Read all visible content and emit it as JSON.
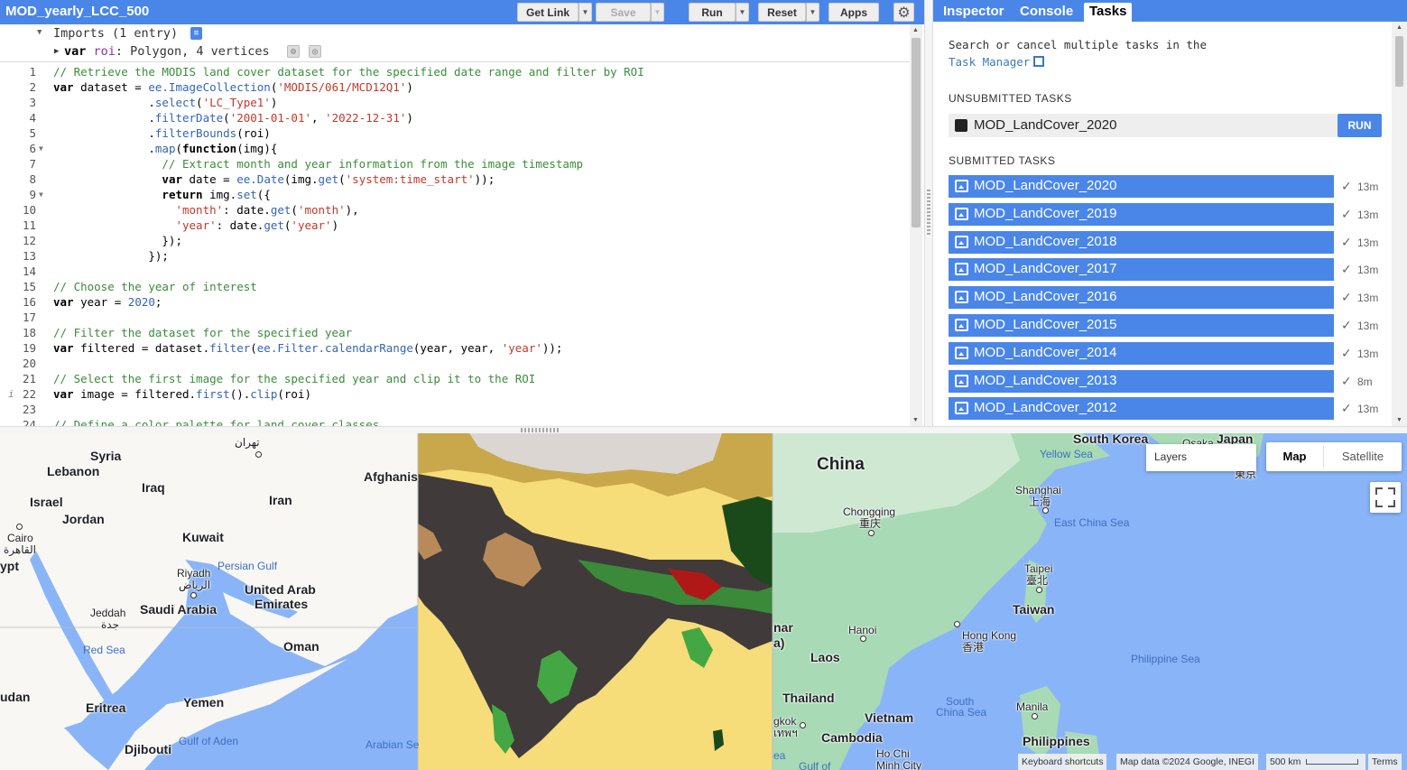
{
  "editor": {
    "script_title": "MOD_yearly_LCC_500",
    "buttons": {
      "get_link": "Get Link",
      "save": "Save",
      "run": "Run",
      "reset": "Reset",
      "apps": "Apps"
    },
    "imports_label": "Imports (1 entry)",
    "import_entry": {
      "keyword": "var",
      "name": "roi",
      "description": ": Polygon, 4 vertices"
    },
    "code_lines": [
      {
        "n": "1",
        "segments": [
          {
            "t": "// Retrieve the MODIS land cover dataset for the specified date range and filter by ROI",
            "c": "c"
          }
        ]
      },
      {
        "n": "2",
        "segments": [
          {
            "t": "var",
            "c": "k"
          },
          {
            "t": " dataset = ",
            "c": "p"
          },
          {
            "t": "ee.ImageCollection",
            "c": "f"
          },
          {
            "t": "(",
            "c": "p"
          },
          {
            "t": "'MODIS/061/MCD12Q1'",
            "c": "s"
          },
          {
            "t": ")",
            "c": "p"
          }
        ]
      },
      {
        "n": "3",
        "segments": [
          {
            "t": "              .",
            "c": "p"
          },
          {
            "t": "select",
            "c": "f"
          },
          {
            "t": "(",
            "c": "p"
          },
          {
            "t": "'LC_Type1'",
            "c": "s"
          },
          {
            "t": ")",
            "c": "p"
          }
        ]
      },
      {
        "n": "4",
        "segments": [
          {
            "t": "              .",
            "c": "p"
          },
          {
            "t": "filterDate",
            "c": "f"
          },
          {
            "t": "(",
            "c": "p"
          },
          {
            "t": "'2001-01-01'",
            "c": "s"
          },
          {
            "t": ", ",
            "c": "p"
          },
          {
            "t": "'2022-12-31'",
            "c": "s"
          },
          {
            "t": ")",
            "c": "p"
          }
        ]
      },
      {
        "n": "5",
        "segments": [
          {
            "t": "              .",
            "c": "p"
          },
          {
            "t": "filterBounds",
            "c": "f"
          },
          {
            "t": "(roi)",
            "c": "p"
          }
        ]
      },
      {
        "n": "6",
        "fold": true,
        "segments": [
          {
            "t": "              .",
            "c": "p"
          },
          {
            "t": "map",
            "c": "f"
          },
          {
            "t": "(",
            "c": "p"
          },
          {
            "t": "function",
            "c": "k"
          },
          {
            "t": "(img){",
            "c": "p"
          }
        ]
      },
      {
        "n": "7",
        "segments": [
          {
            "t": "                // Extract month and year information from the image timestamp",
            "c": "c"
          }
        ]
      },
      {
        "n": "8",
        "segments": [
          {
            "t": "                ",
            "c": "p"
          },
          {
            "t": "var",
            "c": "k"
          },
          {
            "t": " date = ",
            "c": "p"
          },
          {
            "t": "ee.Date",
            "c": "f"
          },
          {
            "t": "(img.",
            "c": "p"
          },
          {
            "t": "get",
            "c": "f"
          },
          {
            "t": "(",
            "c": "p"
          },
          {
            "t": "'system:time_start'",
            "c": "s"
          },
          {
            "t": "));",
            "c": "p"
          }
        ]
      },
      {
        "n": "9",
        "fold": true,
        "segments": [
          {
            "t": "                ",
            "c": "p"
          },
          {
            "t": "return",
            "c": "k"
          },
          {
            "t": " img.",
            "c": "p"
          },
          {
            "t": "set",
            "c": "f"
          },
          {
            "t": "({",
            "c": "p"
          }
        ]
      },
      {
        "n": "10",
        "segments": [
          {
            "t": "                  ",
            "c": "p"
          },
          {
            "t": "'month'",
            "c": "s"
          },
          {
            "t": ": date.",
            "c": "p"
          },
          {
            "t": "get",
            "c": "f"
          },
          {
            "t": "(",
            "c": "p"
          },
          {
            "t": "'month'",
            "c": "s"
          },
          {
            "t": "),",
            "c": "p"
          }
        ]
      },
      {
        "n": "11",
        "segments": [
          {
            "t": "                  ",
            "c": "p"
          },
          {
            "t": "'year'",
            "c": "s"
          },
          {
            "t": ": date.",
            "c": "p"
          },
          {
            "t": "get",
            "c": "f"
          },
          {
            "t": "(",
            "c": "p"
          },
          {
            "t": "'year'",
            "c": "s"
          },
          {
            "t": ")",
            "c": "p"
          }
        ]
      },
      {
        "n": "12",
        "segments": [
          {
            "t": "                });",
            "c": "p"
          }
        ]
      },
      {
        "n": "13",
        "segments": [
          {
            "t": "              });",
            "c": "p"
          }
        ]
      },
      {
        "n": "14",
        "segments": []
      },
      {
        "n": "15",
        "segments": [
          {
            "t": "// Choose the year of interest",
            "c": "c"
          }
        ]
      },
      {
        "n": "16",
        "segments": [
          {
            "t": "var",
            "c": "k"
          },
          {
            "t": " year = ",
            "c": "p"
          },
          {
            "t": "2020",
            "c": "n"
          },
          {
            "t": ";",
            "c": "p"
          }
        ]
      },
      {
        "n": "17",
        "segments": []
      },
      {
        "n": "18",
        "segments": [
          {
            "t": "// Filter the dataset for the specified year",
            "c": "c"
          }
        ]
      },
      {
        "n": "19",
        "segments": [
          {
            "t": "var",
            "c": "k"
          },
          {
            "t": " filtered = dataset.",
            "c": "p"
          },
          {
            "t": "filter",
            "c": "f"
          },
          {
            "t": "(",
            "c": "p"
          },
          {
            "t": "ee.Filter.calendarRange",
            "c": "f"
          },
          {
            "t": "(year, year, ",
            "c": "p"
          },
          {
            "t": "'year'",
            "c": "s"
          },
          {
            "t": "));",
            "c": "p"
          }
        ]
      },
      {
        "n": "20",
        "segments": []
      },
      {
        "n": "21",
        "segments": [
          {
            "t": "// Select the first image for the specified year and clip it to the ROI",
            "c": "c"
          }
        ]
      },
      {
        "n": "22",
        "info": true,
        "segments": [
          {
            "t": "var",
            "c": "k"
          },
          {
            "t": " image = filtered.",
            "c": "p"
          },
          {
            "t": "first",
            "c": "f"
          },
          {
            "t": "().",
            "c": "p"
          },
          {
            "t": "clip",
            "c": "f"
          },
          {
            "t": "(roi)",
            "c": "p"
          }
        ]
      },
      {
        "n": "23",
        "segments": []
      },
      {
        "n": "24",
        "segments": [
          {
            "t": "// Define a color palette for land cover classes",
            "c": "c"
          }
        ]
      }
    ]
  },
  "right_panel": {
    "tabs": [
      "Inspector",
      "Console",
      "Tasks"
    ],
    "active_tab": "Tasks",
    "help_text_line1": "Search or cancel multiple tasks in the",
    "help_link": "Task Manager",
    "unsubmitted_header": "UNSUBMITTED TASKS",
    "unsubmitted_tasks": [
      {
        "name": "MOD_LandCover_2020",
        "action": "RUN"
      }
    ],
    "submitted_header": "SUBMITTED TASKS",
    "submitted_tasks": [
      {
        "name": "MOD_LandCover_2020",
        "time": "13m"
      },
      {
        "name": "MOD_LandCover_2019",
        "time": "13m"
      },
      {
        "name": "MOD_LandCover_2018",
        "time": "13m"
      },
      {
        "name": "MOD_LandCover_2017",
        "time": "13m"
      },
      {
        "name": "MOD_LandCover_2016",
        "time": "13m"
      },
      {
        "name": "MOD_LandCover_2015",
        "time": "13m"
      },
      {
        "name": "MOD_LandCover_2014",
        "time": "13m"
      },
      {
        "name": "MOD_LandCover_2013",
        "time": "8m"
      },
      {
        "name": "MOD_LandCover_2012",
        "time": "13m"
      }
    ],
    "check_glyph": "✓"
  },
  "map": {
    "layers_label": "Layers",
    "map_type": {
      "map": "Map",
      "satellite": "Satellite",
      "selected": "Map"
    },
    "labels": [
      {
        "id": "syria",
        "text": "Syria"
      },
      {
        "id": "lebanon",
        "text": "Lebanon"
      },
      {
        "id": "tehran",
        "text": "تهران"
      },
      {
        "id": "afghanistan",
        "text": "Afghanis"
      },
      {
        "id": "iraq",
        "text": "Iraq"
      },
      {
        "id": "israel",
        "text": "Israel"
      },
      {
        "id": "iran",
        "text": "Iran"
      },
      {
        "id": "jordan",
        "text": "Jordan"
      },
      {
        "id": "cairo",
        "text": "Cairo"
      },
      {
        "id": "cairo_ar",
        "text": "القاهرة"
      },
      {
        "id": "kuwait",
        "text": "Kuwait"
      },
      {
        "id": "egypt",
        "text": "ypt"
      },
      {
        "id": "persian_gulf",
        "text": "Persian Gulf"
      },
      {
        "id": "riyadh",
        "text": "Riyadh"
      },
      {
        "id": "riyadh_ar",
        "text": "الرياض"
      },
      {
        "id": "uae",
        "text": "United Arab"
      },
      {
        "id": "uae2",
        "text": "Emirates"
      },
      {
        "id": "jeddah",
        "text": "Jeddah"
      },
      {
        "id": "jeddah_ar",
        "text": "جدة"
      },
      {
        "id": "saudi",
        "text": "Saudi Arabia"
      },
      {
        "id": "red_sea",
        "text": "Red Sea"
      },
      {
        "id": "oman",
        "text": "Oman"
      },
      {
        "id": "sudan",
        "text": "udan"
      },
      {
        "id": "yemen",
        "text": "Yemen"
      },
      {
        "id": "eritrea",
        "text": "Eritrea"
      },
      {
        "id": "gulf_aden",
        "text": "Gulf of Aden"
      },
      {
        "id": "arabian_sea",
        "text": "Arabian Se"
      },
      {
        "id": "djibouti",
        "text": "Djibouti"
      },
      {
        "id": "south_korea",
        "text": "South Korea"
      },
      {
        "id": "osaka",
        "text": "Osaka"
      },
      {
        "id": "japan",
        "text": "Japan"
      },
      {
        "id": "tokyo",
        "text": "東京"
      },
      {
        "id": "yellow_sea",
        "text": "Yellow Sea"
      },
      {
        "id": "china",
        "text": "China"
      },
      {
        "id": "shanghai",
        "text": "Shanghai"
      },
      {
        "id": "shanghai_cn",
        "text": "上海"
      },
      {
        "id": "chongqing",
        "text": "Chongqing"
      },
      {
        "id": "chongqing_cn",
        "text": "重庆"
      },
      {
        "id": "east_china_sea",
        "text": "East China Sea"
      },
      {
        "id": "taipei",
        "text": "Taipei"
      },
      {
        "id": "taipei_cn",
        "text": "臺北"
      },
      {
        "id": "taiwan",
        "text": "Taiwan"
      },
      {
        "id": "myanmar",
        "text": "nar"
      },
      {
        "id": "myanmar2",
        "text": "a)"
      },
      {
        "id": "hanoi",
        "text": "Hanoi"
      },
      {
        "id": "laos",
        "text": "Laos"
      },
      {
        "id": "hong_kong",
        "text": "Hong Kong"
      },
      {
        "id": "hong_kong_cn",
        "text": "香港"
      },
      {
        "id": "philippine_sea",
        "text": "Philippine Sea"
      },
      {
        "id": "thailand",
        "text": "Thailand"
      },
      {
        "id": "south_china_sea",
        "text": "South"
      },
      {
        "id": "south_china_sea2",
        "text": "China Sea"
      },
      {
        "id": "manila",
        "text": "Manila"
      },
      {
        "id": "bangkok",
        "text": "gkok"
      },
      {
        "id": "bangkok_th",
        "text": "เทพฯ"
      },
      {
        "id": "vietnam",
        "text": "Vietnam"
      },
      {
        "id": "cambodia",
        "text": "Cambodia"
      },
      {
        "id": "philippines",
        "text": "Philippines"
      },
      {
        "id": "hochiminh",
        "text": "Ho Chi"
      },
      {
        "id": "hochiminh2",
        "text": "Minh City"
      },
      {
        "id": "ea",
        "text": "ea"
      },
      {
        "id": "gulf_of",
        "text": "Gulf of"
      }
    ],
    "attribution": {
      "shortcuts": "Keyboard shortcuts",
      "map_data": "Map data ©2024 Google, INEGI",
      "scale": "500 km",
      "terms": "Terms"
    },
    "colors": {
      "water": "#8ab4f8",
      "land": "#f8f7f3",
      "green_land": "#a8dab5",
      "overlay_bg": "#f7dc7a",
      "overlay_dark": "#403a3a"
    }
  }
}
